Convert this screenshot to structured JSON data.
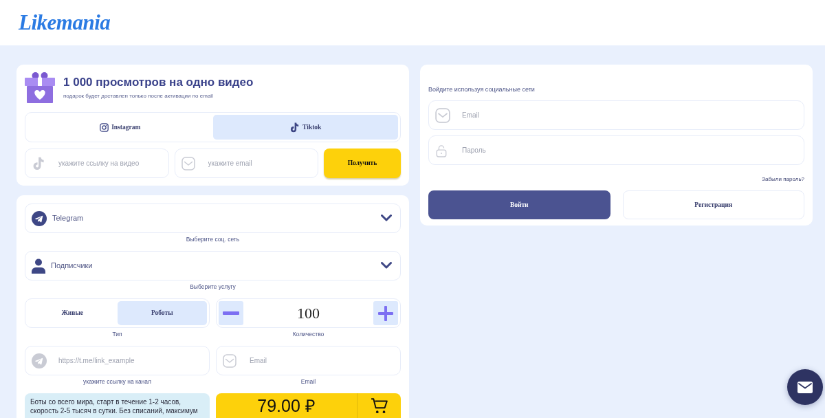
{
  "header": {
    "logo": "Likemania"
  },
  "gift_card": {
    "title": "1 000 просмотров на одно видео",
    "subtitle": "подарок будет доставлен только после активации по email",
    "tabs": [
      {
        "label": "Instagram",
        "kind": "camera",
        "selected": false
      },
      {
        "label": "Tiktok",
        "kind": "note",
        "selected": true
      }
    ],
    "video_field": {
      "placeholder": "укажите ссылку на видео"
    },
    "email_field": {
      "placeholder": "укажите email"
    },
    "submit_button": "Получить"
  },
  "order_card": {
    "network_select": {
      "value": "Telegram",
      "hint": "Выберите соц. сеть"
    },
    "service_select": {
      "value": "Подписчики",
      "hint": "Выберите услугу"
    },
    "type_toggle": {
      "options": [
        {
          "label": "Живые",
          "selected": false
        },
        {
          "label": "Роботы",
          "selected": true
        }
      ],
      "hint": "Тип"
    },
    "quantity": {
      "value": "100",
      "hint": "Количество"
    },
    "link_field": {
      "placeholder": "https://t.me/link_example",
      "hint": "укажите ссылку на канал"
    },
    "email_field": {
      "placeholder": "Email",
      "hint": "Email"
    },
    "description": "Боты со всего мира, старт в течение 1-2 часов, скорость 2-5 тысяч в сутки. Без списаний, максимум",
    "price": "79.00 ₽"
  },
  "login_card": {
    "prompt": "Войдите используя социальные сети",
    "email_field": {
      "placeholder": "Email"
    },
    "password_field": {
      "placeholder": "Пароль"
    },
    "forgot_link": "Забыли пароль?",
    "login_button": "Войти",
    "register_button": "Регистрация"
  }
}
